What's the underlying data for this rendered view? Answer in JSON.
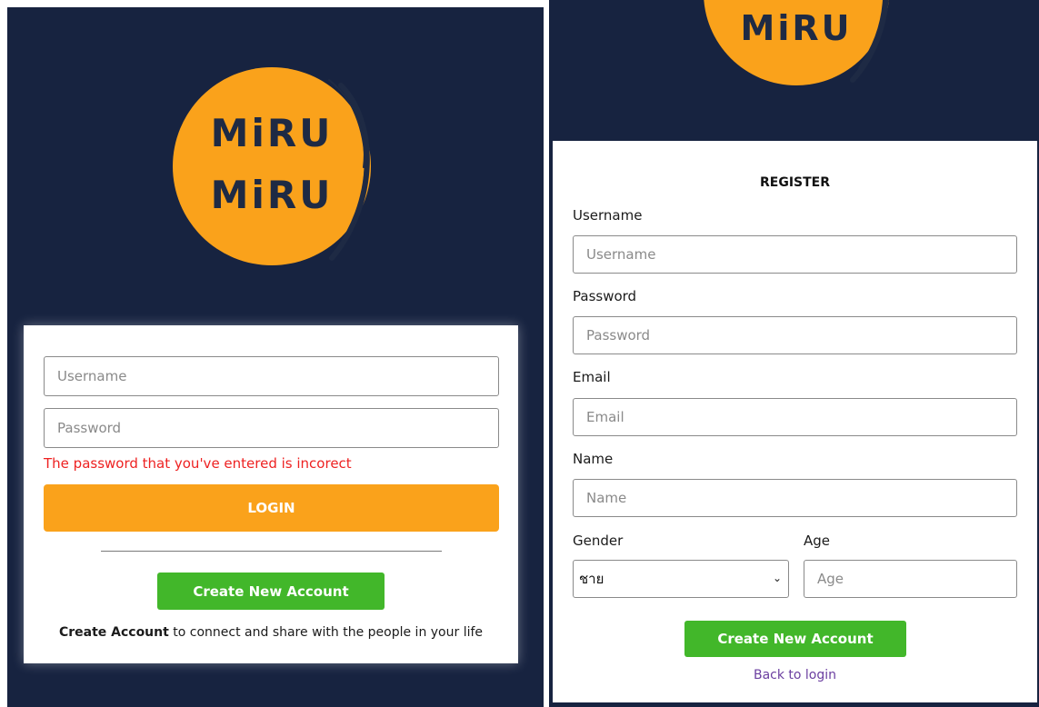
{
  "brand": {
    "logo_line1": "MiRU",
    "logo_line2": "MiRU",
    "color_primary": "#faa21b",
    "color_background": "#172340",
    "color_green": "#42b72a",
    "color_error": "#ee2222"
  },
  "login": {
    "username_placeholder": "Username",
    "password_placeholder": "Password",
    "error_message": "The password that you've entered is incorect",
    "login_label": "LOGIN",
    "create_account_label": "Create New Account",
    "tagline_bold": "Create Account",
    "tagline_rest": " to connect and share with the people in your life"
  },
  "register": {
    "title": "REGISTER",
    "username_label": "Username",
    "username_placeholder": "Username",
    "password_label": "Password",
    "password_placeholder": "Password",
    "email_label": "Email",
    "email_placeholder": "Email",
    "name_label": "Name",
    "name_placeholder": "Name",
    "gender_label": "Gender",
    "gender_selected": "ชาย",
    "age_label": "Age",
    "age_placeholder": "Age",
    "create_account_label": "Create New Account",
    "back_link": "Back to login"
  }
}
